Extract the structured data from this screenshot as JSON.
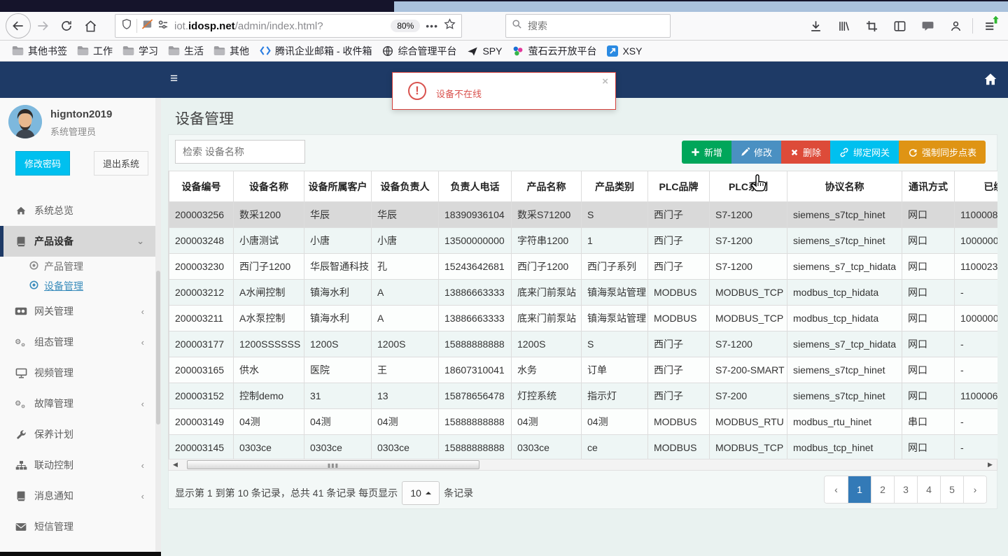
{
  "browser": {
    "url_prefix": "iot.",
    "url_domain": "idosp.net",
    "url_path": "/admin/index.html",
    "zoom_badge": "80%",
    "search_placeholder": "搜索",
    "bookmarks": [
      {
        "icon": "folder",
        "label": "其他书签"
      },
      {
        "icon": "folder",
        "label": "工作"
      },
      {
        "icon": "folder",
        "label": "学习"
      },
      {
        "icon": "folder",
        "label": "生活"
      },
      {
        "icon": "folder",
        "label": "其他"
      },
      {
        "icon": "tencent",
        "label": "腾讯企业邮箱 - 收件箱"
      },
      {
        "icon": "globe",
        "label": "综合管理平台"
      },
      {
        "icon": "plane",
        "label": "SPY"
      },
      {
        "icon": "ys7",
        "label": "萤石云开放平台"
      },
      {
        "icon": "xsy",
        "label": "XSY"
      }
    ]
  },
  "alert": {
    "message": "设备不在线",
    "close": "×"
  },
  "sidebar": {
    "username": "hignton2019",
    "role": "系统管理员",
    "change_password": "修改密码",
    "logout": "退出系统",
    "menu": [
      {
        "icon": "home",
        "label": "系统总览"
      },
      {
        "icon": "book",
        "label": "产品设备",
        "active": true,
        "expanded": true,
        "children": [
          {
            "label": "产品管理",
            "active": false
          },
          {
            "label": "设备管理",
            "active": true
          }
        ]
      },
      {
        "icon": "gateway",
        "label": "网关管理",
        "collapsible": true
      },
      {
        "icon": "cogs",
        "label": "组态管理",
        "collapsible": true
      },
      {
        "icon": "monitor",
        "label": "视频管理"
      },
      {
        "icon": "cogs",
        "label": "故障管理",
        "collapsible": true
      },
      {
        "icon": "wrench",
        "label": "保养计划"
      },
      {
        "icon": "sitemap",
        "label": "联动控制",
        "collapsible": true
      },
      {
        "icon": "book",
        "label": "消息通知",
        "collapsible": true
      },
      {
        "icon": "envelope",
        "label": "短信管理"
      }
    ]
  },
  "page": {
    "title": "设备管理",
    "search_placeholder": "检索 设备名称",
    "toolbar": [
      {
        "label": "新增",
        "color": "#00a65a",
        "icon": "plus"
      },
      {
        "label": "修改",
        "color": "#4a90c2",
        "icon": "pencil"
      },
      {
        "label": "删除",
        "color": "#dd4b39",
        "icon": "cross"
      },
      {
        "label": "绑定网关",
        "color": "#00c0ef",
        "icon": "link"
      },
      {
        "label": "强制同步点表",
        "color": "#df9414",
        "icon": "refresh"
      }
    ],
    "table": {
      "headers": [
        "设备编号",
        "设备名称",
        "设备所属客户",
        "设备负责人",
        "负责人电话",
        "产品名称",
        "产品类别",
        "PLC品牌",
        "PLC系列",
        "协议名称",
        "通讯方式",
        "已绑定网"
      ],
      "selected_row": 0,
      "rows": [
        [
          "200003256",
          "数采1200",
          "华辰",
          "华辰",
          "18390936104",
          "数采S71200",
          "S",
          "西门子",
          "S7-1200",
          "siemens_s7tcp_hinet",
          "网口",
          "1100008"
        ],
        [
          "200003248",
          "小唐测试",
          "小唐",
          "小唐",
          "13500000000",
          "字符串1200",
          "1",
          "西门子",
          "S7-1200",
          "siemens_s7tcp_hinet",
          "网口",
          "1000000"
        ],
        [
          "200003230",
          "西门子1200",
          "华辰智通科技",
          "孔",
          "15243642681",
          "西门子1200",
          "西门子系列",
          "西门子",
          "S7-1200",
          "siemens_s7_tcp_hidata",
          "网口",
          "1100023"
        ],
        [
          "200003212",
          "A水闸控制",
          "镇海水利",
          "A",
          "13886663333",
          "底来门前泵站",
          "镇海泵站管理",
          "MODBUS",
          "MODBUS_TCP",
          "modbus_tcp_hidata",
          "网口",
          "-"
        ],
        [
          "200003211",
          "A水泵控制",
          "镇海水利",
          "A",
          "13886663333",
          "底来门前泵站",
          "镇海泵站管理",
          "MODBUS",
          "MODBUS_TCP",
          "modbus_tcp_hidata",
          "网口",
          "1000000"
        ],
        [
          "200003177",
          "1200SSSSSS",
          "1200S",
          "1200S",
          "15888888888",
          "1200S",
          "S",
          "西门子",
          "S7-1200",
          "siemens_s7_tcp_hidata",
          "网口",
          "-"
        ],
        [
          "200003165",
          "供水",
          "医院",
          "王",
          "18607310041",
          "水务",
          "订单",
          "西门子",
          "S7-200-SMART",
          "siemens_s7tcp_hinet",
          "网口",
          "-"
        ],
        [
          "200003152",
          "控制demo",
          "31",
          "13",
          "15878656478",
          "灯控系统",
          "指示灯",
          "西门子",
          "S7-200",
          "siemens_s7tcp_hinet",
          "网口",
          "1100006"
        ],
        [
          "200003149",
          "04测",
          "04测",
          "04测",
          "15888888888",
          "04测",
          "04测",
          "MODBUS",
          "MODBUS_RTU",
          "modbus_rtu_hinet",
          "串口",
          "-"
        ],
        [
          "200003145",
          "0303ce",
          "0303ce",
          "0303ce",
          "15888888888",
          "0303ce",
          "ce",
          "MODBUS",
          "MODBUS_TCP",
          "modbus_tcp_hinet",
          "网口",
          "-"
        ]
      ]
    },
    "pagination": {
      "info": "显示第 1 到第 10 条记录，总共 41 条记录 每页显示",
      "page_size": "10",
      "info_suffix": "条记录",
      "pages": [
        "1",
        "2",
        "3",
        "4",
        "5"
      ],
      "active_page": "1",
      "prev": "‹",
      "next": "›"
    }
  }
}
